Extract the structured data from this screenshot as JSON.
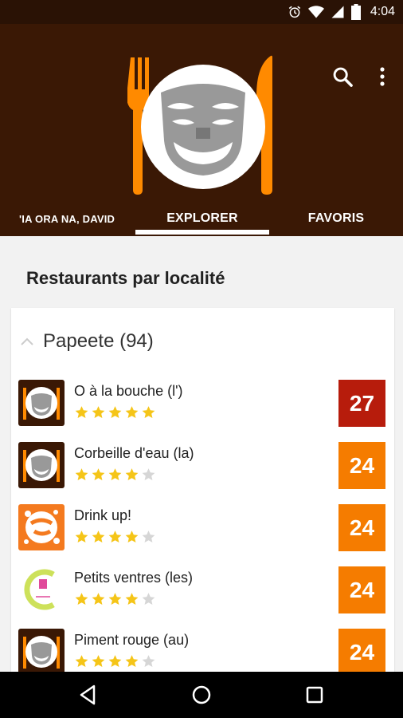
{
  "status_bar": {
    "time": "4:04",
    "icons": [
      "alarm-icon",
      "wifi-icon",
      "signal-icon",
      "battery-icon"
    ]
  },
  "header": {
    "logo": "fork-knife-tiki-mask-logo",
    "actions": [
      "search-icon",
      "more-vert-icon"
    ]
  },
  "tabs": [
    {
      "label": "'IA ORA NA, DAVID",
      "selected": false
    },
    {
      "label": "EXPLORER",
      "selected": true
    },
    {
      "label": "FAVORIS",
      "selected": false
    }
  ],
  "section": {
    "title": "Restaurants par localité"
  },
  "group": {
    "name": "Papeete (94)",
    "expanded": true,
    "icon": "chevron-up-icon"
  },
  "restaurants": [
    {
      "name": "O à la bouche (l')",
      "rating": 5,
      "score": "27",
      "score_color": "#b71c0c",
      "thumb": "tiki-logo"
    },
    {
      "name": "Corbeille d'eau (la)",
      "rating": 4,
      "score": "24",
      "score_color": "#f57c00",
      "thumb": "tiki-logo"
    },
    {
      "name": "Drink up!",
      "rating": 4,
      "score": "24",
      "score_color": "#f57c00",
      "thumb": "drink-up-logo"
    },
    {
      "name": "Petits ventres (les)",
      "rating": 4,
      "score": "24",
      "score_color": "#f57c00",
      "thumb": "petits-ventres-logo"
    },
    {
      "name": "Piment rouge (au)",
      "rating": 4,
      "score": "24",
      "score_color": "#f57c00",
      "thumb": "tiki-logo"
    }
  ],
  "colors": {
    "header_bg": "#3a1805",
    "accent_orange": "#f57c00",
    "accent_red": "#b71c0c",
    "star_gold": "#f5c518",
    "star_empty": "#d6d6d6"
  },
  "nav": [
    "back-icon",
    "home-icon",
    "recents-icon"
  ]
}
